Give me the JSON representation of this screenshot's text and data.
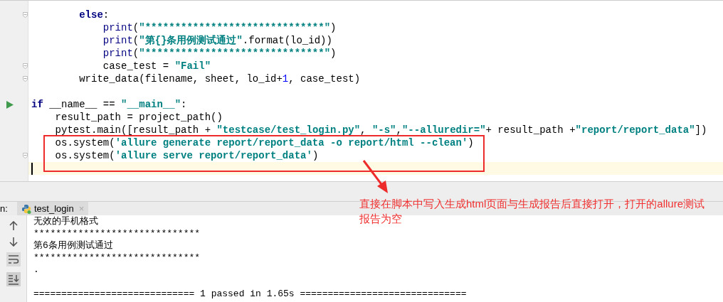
{
  "editor": {
    "lines": [
      {
        "kind": "fold",
        "current": false,
        "tokens": [
          {
            "kind": "keyword",
            "text": "        else"
          },
          {
            "kind": "plain",
            "text": ":"
          }
        ]
      },
      {
        "kind": "plain",
        "current": false,
        "tokens": [
          {
            "kind": "builtin",
            "text": "            print"
          },
          {
            "kind": "plain",
            "text": "("
          },
          {
            "kind": "string",
            "text": "\"******************************\""
          },
          {
            "kind": "plain",
            "text": ")"
          }
        ]
      },
      {
        "kind": "plain",
        "current": false,
        "tokens": [
          {
            "kind": "builtin",
            "text": "            print"
          },
          {
            "kind": "plain",
            "text": "("
          },
          {
            "kind": "string",
            "text": "\"第{}条用例测试通过\""
          },
          {
            "kind": "plain",
            "text": ".format(lo_id))"
          }
        ]
      },
      {
        "kind": "plain",
        "current": false,
        "tokens": [
          {
            "kind": "builtin",
            "text": "            print"
          },
          {
            "kind": "plain",
            "text": "("
          },
          {
            "kind": "string",
            "text": "\"******************************\""
          },
          {
            "kind": "plain",
            "text": ")"
          }
        ]
      },
      {
        "kind": "fold",
        "current": false,
        "tokens": [
          {
            "kind": "plain",
            "text": "            case_test = "
          },
          {
            "kind": "string",
            "text": "\"Fail\""
          }
        ]
      },
      {
        "kind": "fold",
        "current": false,
        "tokens": [
          {
            "kind": "plain",
            "text": "        write_data(filename, sheet, lo_id+"
          },
          {
            "kind": "number",
            "text": "1"
          },
          {
            "kind": "plain",
            "text": ", case_test)"
          }
        ]
      },
      {
        "kind": "plain",
        "current": false
      },
      {
        "kind": "run",
        "current": false,
        "tokens": [
          {
            "kind": "keyword",
            "text": "if"
          },
          {
            "kind": "plain",
            "text": " __name__ == "
          },
          {
            "kind": "string",
            "text": "\"__main__\""
          },
          {
            "kind": "plain",
            "text": ":"
          }
        ]
      },
      {
        "kind": "plain",
        "current": false,
        "tokens": [
          {
            "kind": "plain",
            "text": "    result_path = project_path()"
          }
        ]
      },
      {
        "kind": "plain",
        "current": false,
        "tokens": [
          {
            "kind": "plain",
            "text": "    pytest.main([result_path + "
          },
          {
            "kind": "string",
            "text": "\"testcase/test_login.py\""
          },
          {
            "kind": "plain",
            "text": ", "
          },
          {
            "kind": "string",
            "text": "\"-s\""
          },
          {
            "kind": "plain",
            "text": ","
          },
          {
            "kind": "string",
            "text": "\"--alluredir=\""
          },
          {
            "kind": "plain",
            "text": "+ result_path +"
          },
          {
            "kind": "string",
            "text": "\"report/report_data\""
          },
          {
            "kind": "plain",
            "text": "])"
          }
        ]
      },
      {
        "kind": "plain",
        "current": false,
        "tokens": [
          {
            "kind": "plain",
            "text": "    os.system("
          },
          {
            "kind": "string",
            "text": "'allure generate report/report_data -o report/html --clean'"
          },
          {
            "kind": "plain",
            "text": ")"
          }
        ]
      },
      {
        "kind": "fold",
        "current": false,
        "tokens": [
          {
            "kind": "plain",
            "text": "    os.system("
          },
          {
            "kind": "string",
            "text": "'allure serve report/report_data'"
          },
          {
            "kind": "plain",
            "text": ")"
          }
        ]
      },
      {
        "kind": "plain",
        "current": true
      }
    ]
  },
  "run_panel": {
    "label": "n:",
    "tabs": [
      {
        "label": "test_login",
        "close": "×",
        "selected": true
      }
    ],
    "output": [
      "无效的手机格式",
      "******************************",
      "第6条用例测试通过",
      "******************************",
      "."
    ],
    "summary": "============================= 1 passed in 1.65s =============================="
  },
  "annotation": {
    "text": "直接在脚本中写入生成html页面与生成报告后直接打开，打开的allure测试报告为空"
  }
}
